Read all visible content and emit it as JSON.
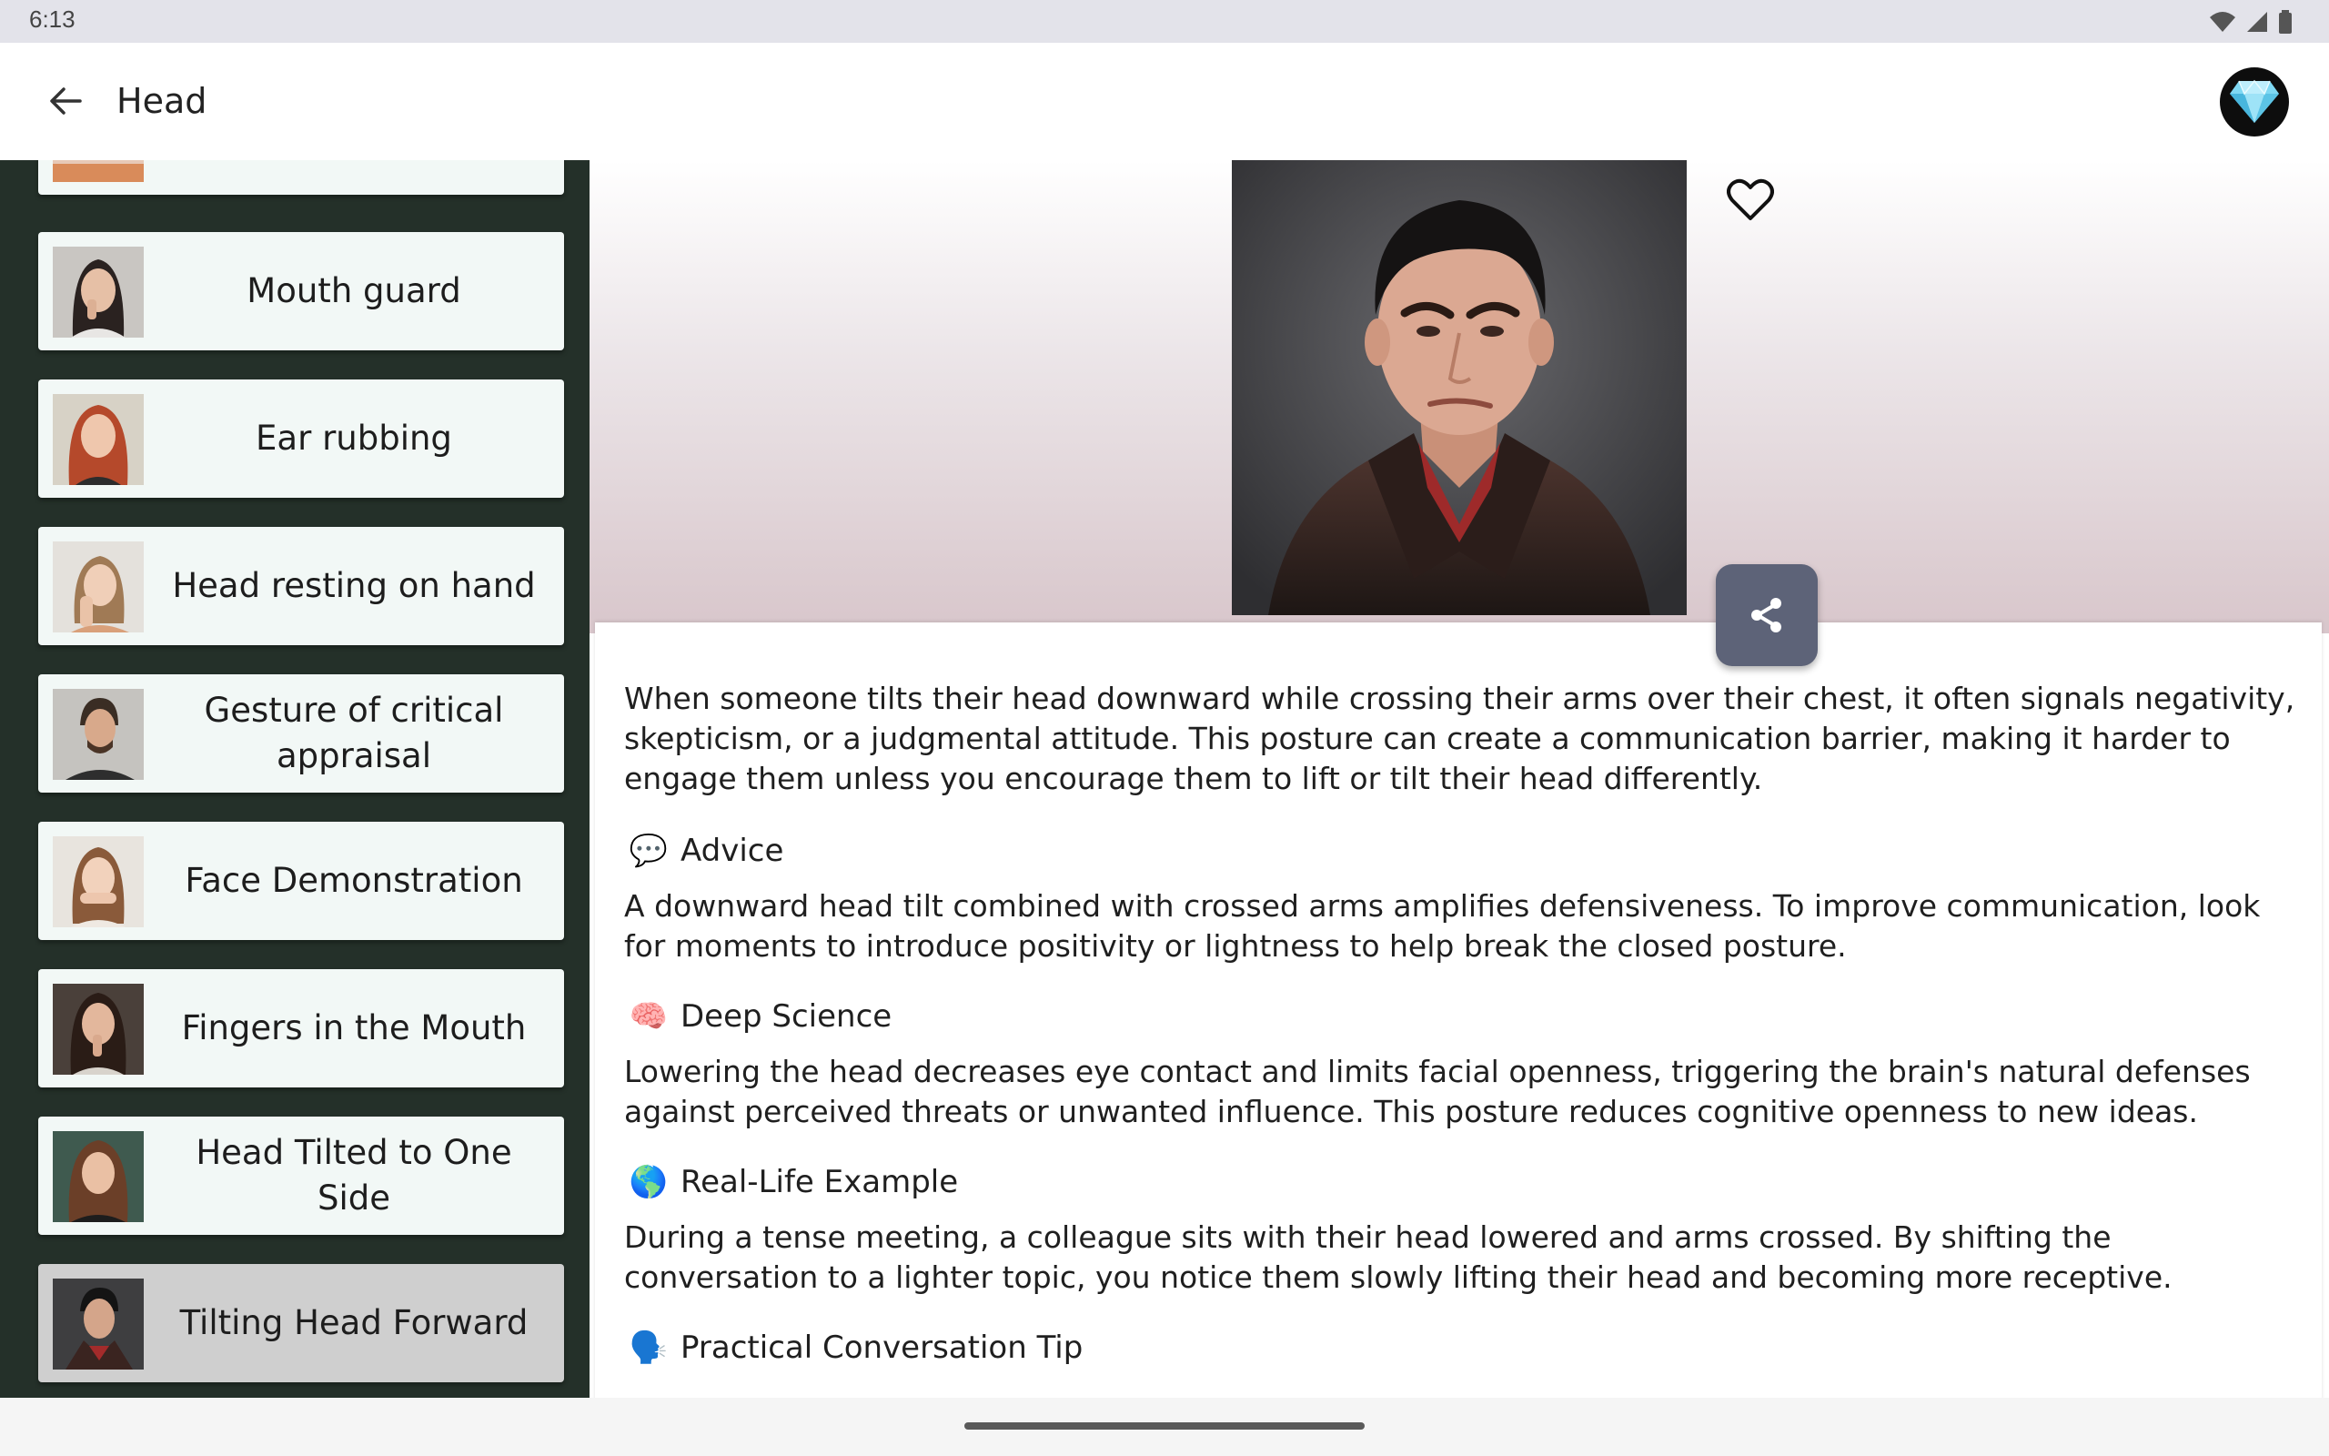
{
  "status_bar": {
    "time": "6:13"
  },
  "app_bar": {
    "title": "Head"
  },
  "list": [
    {
      "label": ""
    },
    {
      "label": "Mouth guard"
    },
    {
      "label": "Ear rubbing"
    },
    {
      "label": "Head resting on hand"
    },
    {
      "label": "Gesture of critical appraisal"
    },
    {
      "label": "Face Demonstration"
    },
    {
      "label": "Fingers in the Mouth"
    },
    {
      "label": "Head Tilted to One Side"
    },
    {
      "label": "Tilting Head Forward"
    }
  ],
  "detail": {
    "intro": "When someone tilts their head downward while crossing their arms over their chest, it often signals negativity, skepticism, or a judgmental attitude. This posture can create a communication barrier, making it harder to engage them unless you encourage them to lift or tilt their head differently.",
    "sections": [
      {
        "emoji": "💬",
        "title": "Advice",
        "body": "A downward head tilt combined with crossed arms amplifies defensiveness. To improve communication, look for moments to introduce positivity or lightness to help break the closed posture."
      },
      {
        "emoji": "🧠",
        "title": "Deep Science",
        "body": "Lowering the head decreases eye contact and limits facial openness, triggering the brain's natural defenses against perceived threats or unwanted influence. This posture reduces cognitive openness to new ideas."
      },
      {
        "emoji": "🌎",
        "title": "Real-Life Example",
        "body": "During a tense meeting, a colleague sits with their head lowered and arms crossed. By shifting the conversation to a lighter topic, you notice them slowly lifting their head and becoming more receptive."
      },
      {
        "emoji": "🗣️",
        "title": "Practical Conversation Tip",
        "body": ""
      }
    ]
  },
  "colors": {
    "sidebar_bg": "#243029",
    "card_bg": "#f2f8f6",
    "card_selected": "#cfcfcf",
    "share_button": "#5d6378"
  }
}
